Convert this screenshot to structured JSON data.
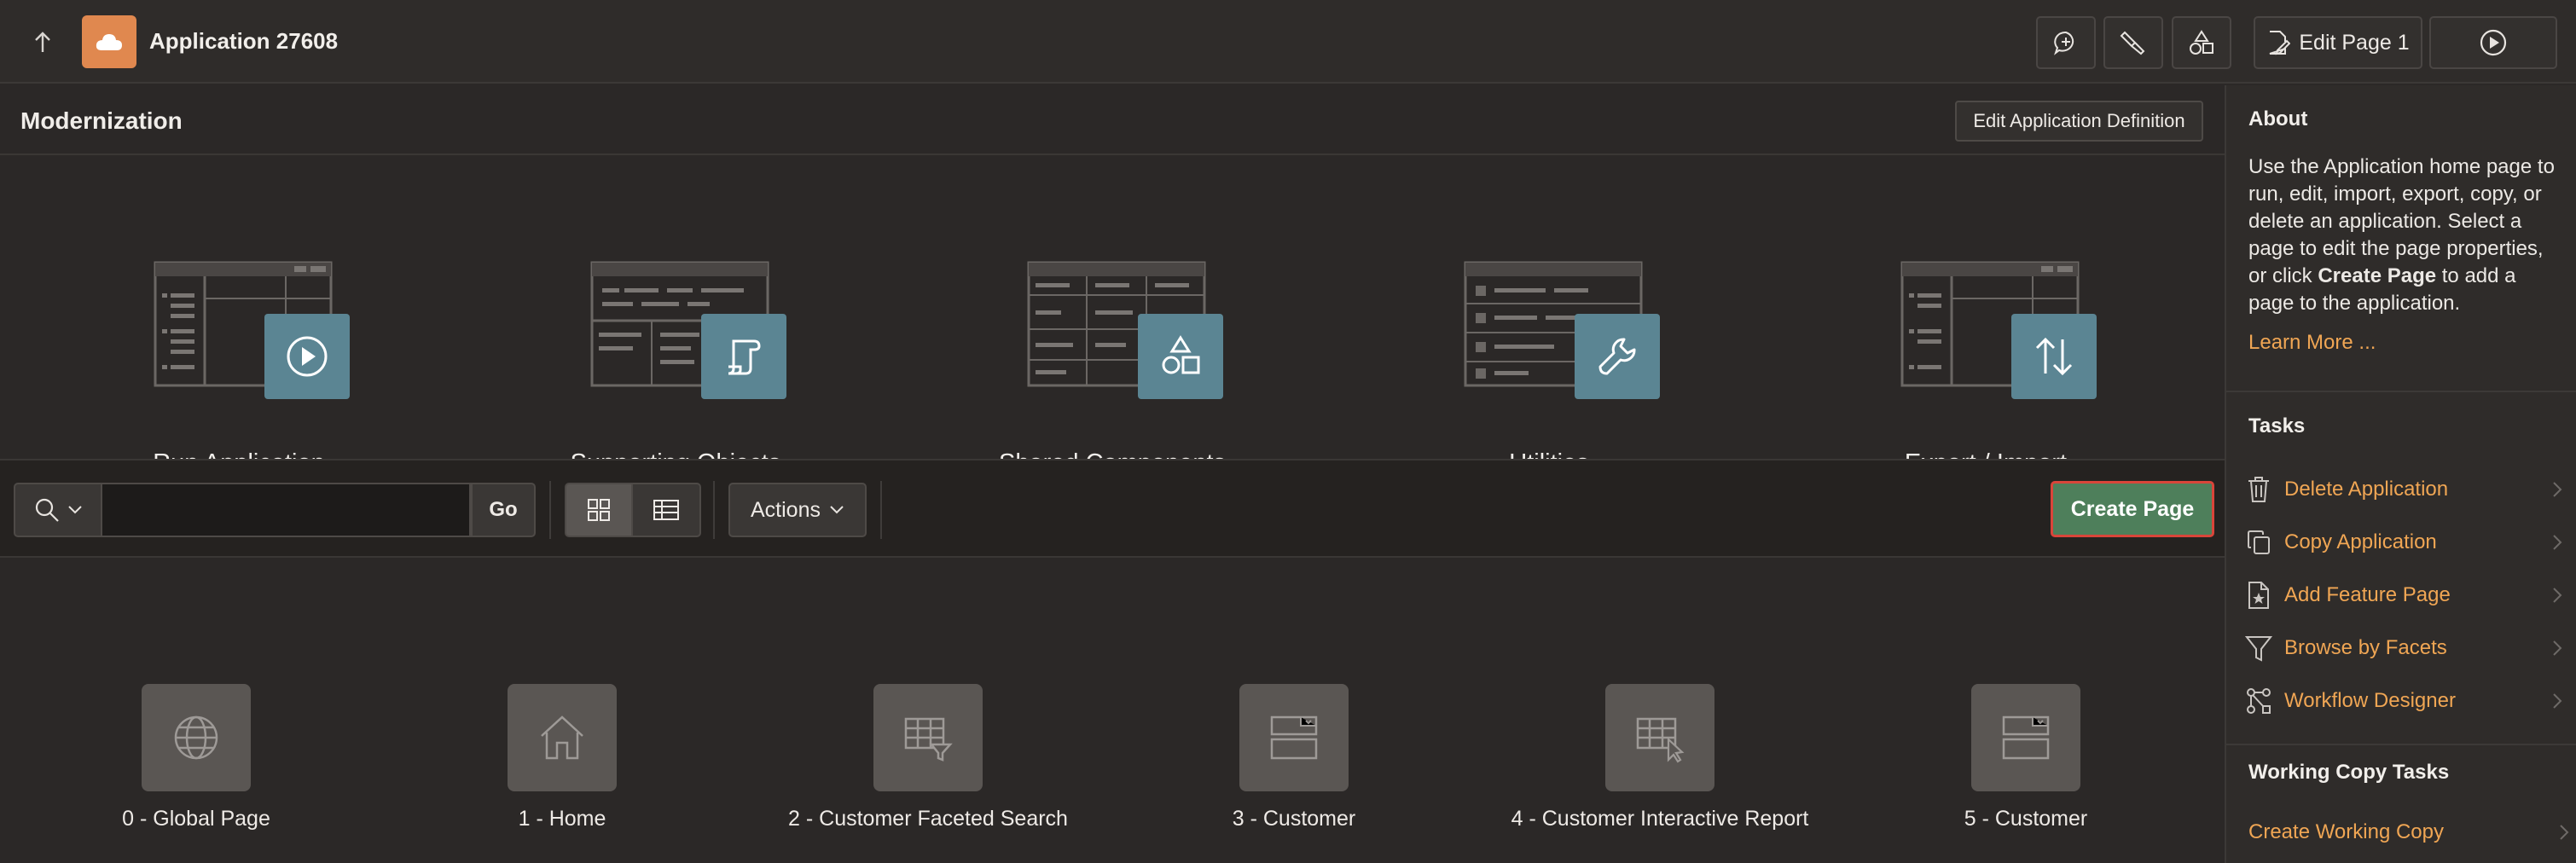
{
  "header": {
    "app_title": "Application 27608",
    "edit_page_label": "Edit Page 1"
  },
  "main": {
    "section_title": "Modernization",
    "edit_definition_label": "Edit Application Definition",
    "tiles": [
      {
        "label": "Run Application",
        "icon": "play-icon"
      },
      {
        "label": "Supporting Objects",
        "icon": "scroll-icon"
      },
      {
        "label": "Shared Components",
        "icon": "shapes-icon"
      },
      {
        "label": "Utilities",
        "icon": "wrench-icon"
      },
      {
        "label": "Export / Import",
        "icon": "up-down-arrows-icon"
      }
    ]
  },
  "toolbar": {
    "search_value": "",
    "go_label": "Go",
    "actions_label": "Actions",
    "create_page_label": "Create Page"
  },
  "pages": [
    {
      "label": "0 - Global Page",
      "icon": "globe-icon"
    },
    {
      "label": "1 - Home",
      "icon": "home-icon"
    },
    {
      "label": "2 - Customer Faceted Search",
      "icon": "faceted-search-icon"
    },
    {
      "label": "3 - Customer",
      "icon": "form-icon"
    },
    {
      "label": "4 - Customer Interactive Report",
      "icon": "interactive-report-icon"
    },
    {
      "label": "5 - Customer",
      "icon": "form-icon"
    }
  ],
  "sidebar": {
    "about_title": "About",
    "about_text_1": "Use the Application home page to run, edit, import, export, copy, or delete an application. Select a page to edit the page properties, or click ",
    "about_bold": "Create Page",
    "about_text_2": " to add a page to the application.",
    "learn_more": "Learn More ...",
    "tasks_title": "Tasks",
    "tasks": [
      {
        "label": "Delete Application",
        "icon": "trash-icon"
      },
      {
        "label": "Copy Application",
        "icon": "copy-icon"
      },
      {
        "label": "Add Feature Page",
        "icon": "feature-page-icon"
      },
      {
        "label": "Browse by Facets",
        "icon": "filter-icon"
      },
      {
        "label": "Workflow Designer",
        "icon": "workflow-icon"
      }
    ],
    "working_copy_title": "Working Copy Tasks",
    "create_working_copy": "Create Working Copy"
  },
  "colors": {
    "background": "#2b2827",
    "accent_orange": "#e0884f",
    "link_orange": "#f0a654",
    "tile_badge": "#5b8593",
    "create_button": "#4e7f5b",
    "create_button_border": "#d9453a"
  }
}
